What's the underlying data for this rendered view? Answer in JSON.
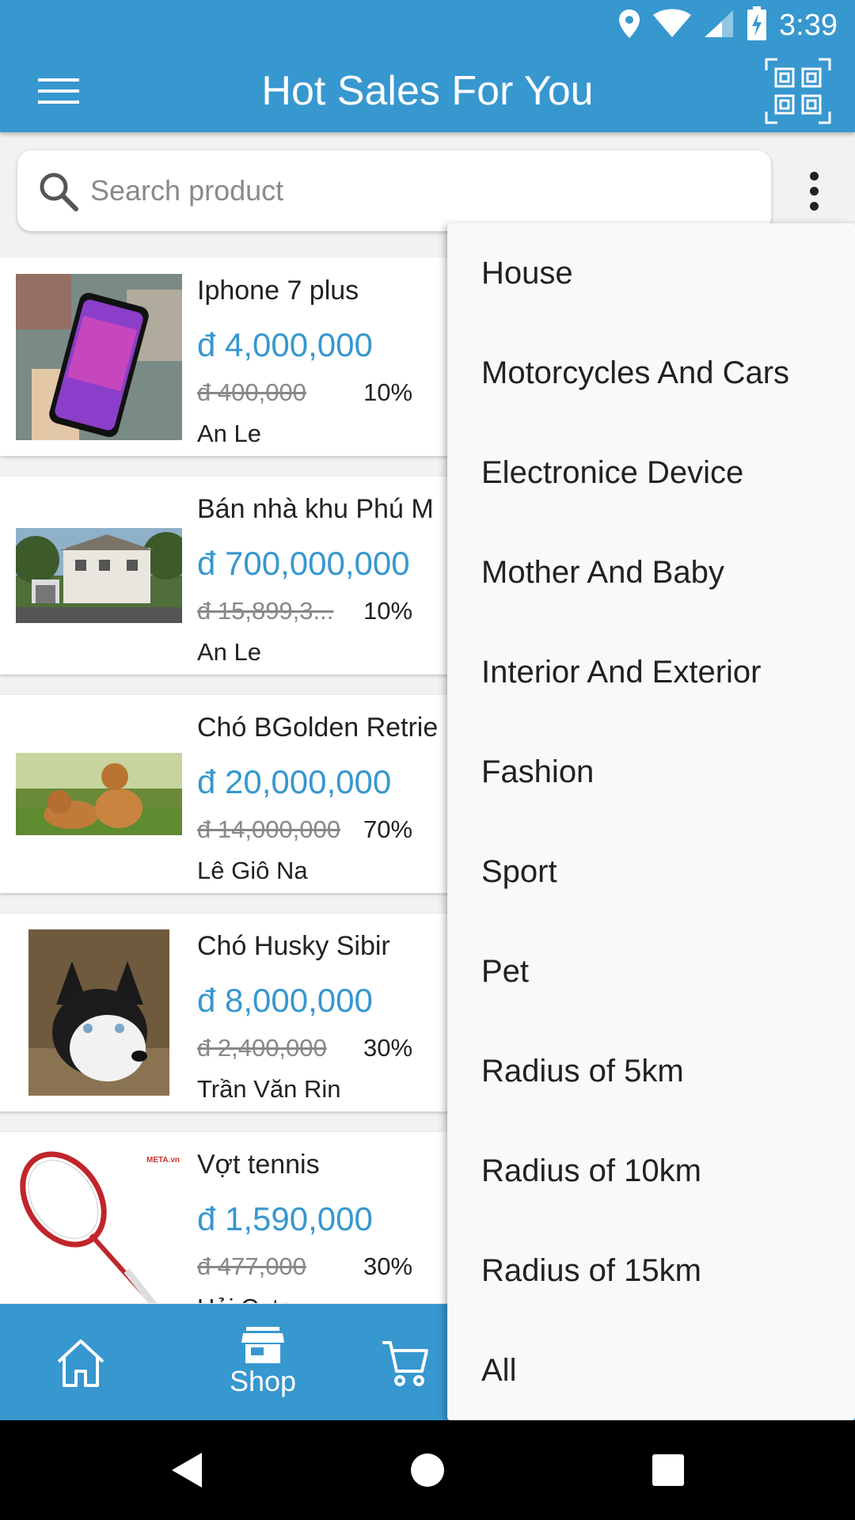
{
  "status_bar": {
    "time": "3:39"
  },
  "app_bar": {
    "title": "Hot Sales For You"
  },
  "search": {
    "placeholder": "Search product"
  },
  "products": [
    {
      "name": "Iphone 7 plus",
      "price": "đ 4,000,000",
      "old_price": "đ 400,000",
      "discount": "10%",
      "seller": "An Le"
    },
    {
      "name": "Bán nhà khu Phú M",
      "price": "đ 700,000,000",
      "old_price": "đ 15,899,3...",
      "discount": "10%",
      "seller": "An Le"
    },
    {
      "name": "Chó BGolden Retrie",
      "price": "đ 20,000,000",
      "old_price": "đ 14,000,000",
      "discount": "70%",
      "seller": "Lê Giô Na"
    },
    {
      "name": "Chó Husky Sibir",
      "price": "đ 8,000,000",
      "old_price": "đ 2,400,000",
      "discount": "30%",
      "seller": "Trần Văn Rin"
    },
    {
      "name": "Vợt tennis",
      "price": "đ 1,590,000",
      "old_price": "đ 477,000",
      "discount": "30%",
      "seller": "Hải Cute",
      "thumb_watermark": "META.vn"
    }
  ],
  "bottom_nav": {
    "shop_label": "Shop"
  },
  "menu": {
    "items": [
      "House",
      "Motorcycles And Cars",
      "Electronice Device",
      "Mother And Baby",
      "Interior And Exterior",
      "Fashion",
      "Sport",
      "Pet",
      "Radius of 5km",
      "Radius of 10km",
      "Radius of 15km",
      "All"
    ]
  },
  "colors": {
    "primary": "#3797cf",
    "menu_bg": "#f9f9f9",
    "text": "#212121"
  },
  "icons": {
    "status": [
      "location-icon",
      "wifi-icon",
      "signal-icon",
      "battery-charging-icon"
    ],
    "app_bar": [
      "hamburger-menu-icon",
      "qr-code-icon"
    ],
    "bottom_nav": [
      "home-icon",
      "shop-icon",
      "cart-icon"
    ],
    "system_nav": [
      "back-icon",
      "home-circle-icon",
      "recents-icon"
    ]
  }
}
